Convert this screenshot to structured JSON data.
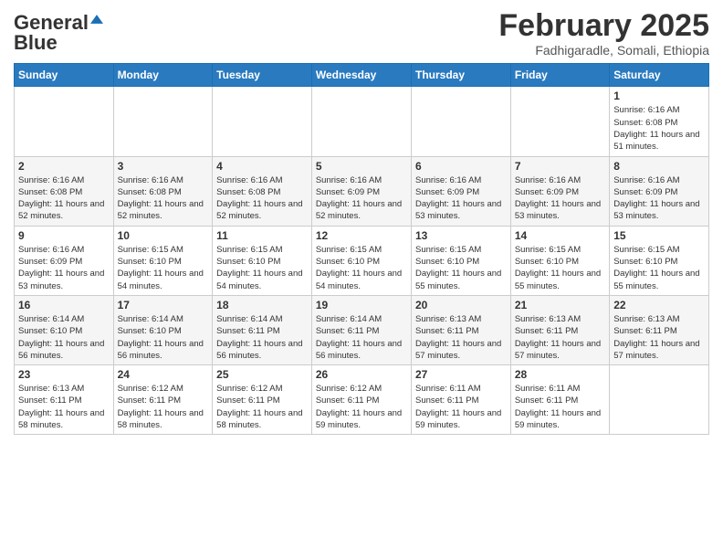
{
  "header": {
    "logo_line1": "General",
    "logo_line2": "Blue",
    "month_year": "February 2025",
    "location": "Fadhigaradle, Somali, Ethiopia"
  },
  "days_of_week": [
    "Sunday",
    "Monday",
    "Tuesday",
    "Wednesday",
    "Thursday",
    "Friday",
    "Saturday"
  ],
  "weeks": [
    [
      {
        "day": "",
        "info": ""
      },
      {
        "day": "",
        "info": ""
      },
      {
        "day": "",
        "info": ""
      },
      {
        "day": "",
        "info": ""
      },
      {
        "day": "",
        "info": ""
      },
      {
        "day": "",
        "info": ""
      },
      {
        "day": "1",
        "info": "Sunrise: 6:16 AM\nSunset: 6:08 PM\nDaylight: 11 hours and 51 minutes."
      }
    ],
    [
      {
        "day": "2",
        "info": "Sunrise: 6:16 AM\nSunset: 6:08 PM\nDaylight: 11 hours and 52 minutes."
      },
      {
        "day": "3",
        "info": "Sunrise: 6:16 AM\nSunset: 6:08 PM\nDaylight: 11 hours and 52 minutes."
      },
      {
        "day": "4",
        "info": "Sunrise: 6:16 AM\nSunset: 6:08 PM\nDaylight: 11 hours and 52 minutes."
      },
      {
        "day": "5",
        "info": "Sunrise: 6:16 AM\nSunset: 6:09 PM\nDaylight: 11 hours and 52 minutes."
      },
      {
        "day": "6",
        "info": "Sunrise: 6:16 AM\nSunset: 6:09 PM\nDaylight: 11 hours and 53 minutes."
      },
      {
        "day": "7",
        "info": "Sunrise: 6:16 AM\nSunset: 6:09 PM\nDaylight: 11 hours and 53 minutes."
      },
      {
        "day": "8",
        "info": "Sunrise: 6:16 AM\nSunset: 6:09 PM\nDaylight: 11 hours and 53 minutes."
      }
    ],
    [
      {
        "day": "9",
        "info": "Sunrise: 6:16 AM\nSunset: 6:09 PM\nDaylight: 11 hours and 53 minutes."
      },
      {
        "day": "10",
        "info": "Sunrise: 6:15 AM\nSunset: 6:10 PM\nDaylight: 11 hours and 54 minutes."
      },
      {
        "day": "11",
        "info": "Sunrise: 6:15 AM\nSunset: 6:10 PM\nDaylight: 11 hours and 54 minutes."
      },
      {
        "day": "12",
        "info": "Sunrise: 6:15 AM\nSunset: 6:10 PM\nDaylight: 11 hours and 54 minutes."
      },
      {
        "day": "13",
        "info": "Sunrise: 6:15 AM\nSunset: 6:10 PM\nDaylight: 11 hours and 55 minutes."
      },
      {
        "day": "14",
        "info": "Sunrise: 6:15 AM\nSunset: 6:10 PM\nDaylight: 11 hours and 55 minutes."
      },
      {
        "day": "15",
        "info": "Sunrise: 6:15 AM\nSunset: 6:10 PM\nDaylight: 11 hours and 55 minutes."
      }
    ],
    [
      {
        "day": "16",
        "info": "Sunrise: 6:14 AM\nSunset: 6:10 PM\nDaylight: 11 hours and 56 minutes."
      },
      {
        "day": "17",
        "info": "Sunrise: 6:14 AM\nSunset: 6:10 PM\nDaylight: 11 hours and 56 minutes."
      },
      {
        "day": "18",
        "info": "Sunrise: 6:14 AM\nSunset: 6:11 PM\nDaylight: 11 hours and 56 minutes."
      },
      {
        "day": "19",
        "info": "Sunrise: 6:14 AM\nSunset: 6:11 PM\nDaylight: 11 hours and 56 minutes."
      },
      {
        "day": "20",
        "info": "Sunrise: 6:13 AM\nSunset: 6:11 PM\nDaylight: 11 hours and 57 minutes."
      },
      {
        "day": "21",
        "info": "Sunrise: 6:13 AM\nSunset: 6:11 PM\nDaylight: 11 hours and 57 minutes."
      },
      {
        "day": "22",
        "info": "Sunrise: 6:13 AM\nSunset: 6:11 PM\nDaylight: 11 hours and 57 minutes."
      }
    ],
    [
      {
        "day": "23",
        "info": "Sunrise: 6:13 AM\nSunset: 6:11 PM\nDaylight: 11 hours and 58 minutes."
      },
      {
        "day": "24",
        "info": "Sunrise: 6:12 AM\nSunset: 6:11 PM\nDaylight: 11 hours and 58 minutes."
      },
      {
        "day": "25",
        "info": "Sunrise: 6:12 AM\nSunset: 6:11 PM\nDaylight: 11 hours and 58 minutes."
      },
      {
        "day": "26",
        "info": "Sunrise: 6:12 AM\nSunset: 6:11 PM\nDaylight: 11 hours and 59 minutes."
      },
      {
        "day": "27",
        "info": "Sunrise: 6:11 AM\nSunset: 6:11 PM\nDaylight: 11 hours and 59 minutes."
      },
      {
        "day": "28",
        "info": "Sunrise: 6:11 AM\nSunset: 6:11 PM\nDaylight: 11 hours and 59 minutes."
      },
      {
        "day": "",
        "info": ""
      }
    ]
  ]
}
